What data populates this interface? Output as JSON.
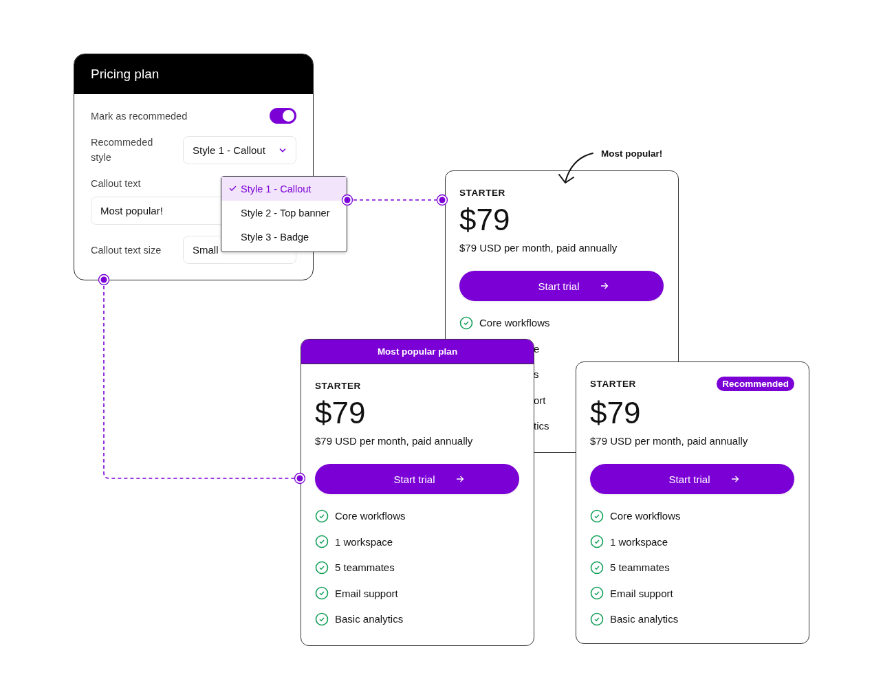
{
  "settings_panel": {
    "title": "Pricing plan",
    "fields": [
      {
        "kind": "toggle",
        "label": "Mark as recommeded",
        "on": true
      },
      {
        "kind": "select",
        "label": "Recommeded style",
        "value": "Style 1 - Callout"
      },
      {
        "kind": "text",
        "label": "Callout text",
        "value": "Most popular!"
      },
      {
        "kind": "select",
        "label": "Callout text size",
        "value": "Small"
      }
    ]
  },
  "style_dropdown": {
    "options": [
      {
        "label": "Style 1 - Callout",
        "selected": true
      },
      {
        "label": "Style 2 - Top banner",
        "selected": false
      },
      {
        "label": "Style 3 - Badge",
        "selected": false
      }
    ]
  },
  "callout_annotation": {
    "text": "Most popular!"
  },
  "cards": [
    {
      "kind": "callout",
      "plan": "STARTER",
      "price": "$79",
      "billing": "$79 USD per month, paid annually",
      "button": "Start trial",
      "features": [
        "Core workflows"
      ],
      "covered_features": [
        "e",
        "s",
        "ort",
        "tics"
      ]
    },
    {
      "kind": "banner",
      "banner": "Most popular plan",
      "plan": "STARTER",
      "price": "$79",
      "billing": "$79 USD per month, paid annually",
      "button": "Start trial",
      "features": [
        "Core workflows",
        "1 workspace",
        "5 teammates",
        "Email support",
        "Basic analytics"
      ]
    },
    {
      "kind": "badge",
      "badge": "Recommended",
      "plan": "STARTER",
      "price": "$79",
      "billing": "$79 USD per month, paid annually",
      "button": "Start trial",
      "features": [
        "Core workflows",
        "1 workspace",
        "5 teammates",
        "Email support",
        "Basic analytics"
      ]
    }
  ]
}
